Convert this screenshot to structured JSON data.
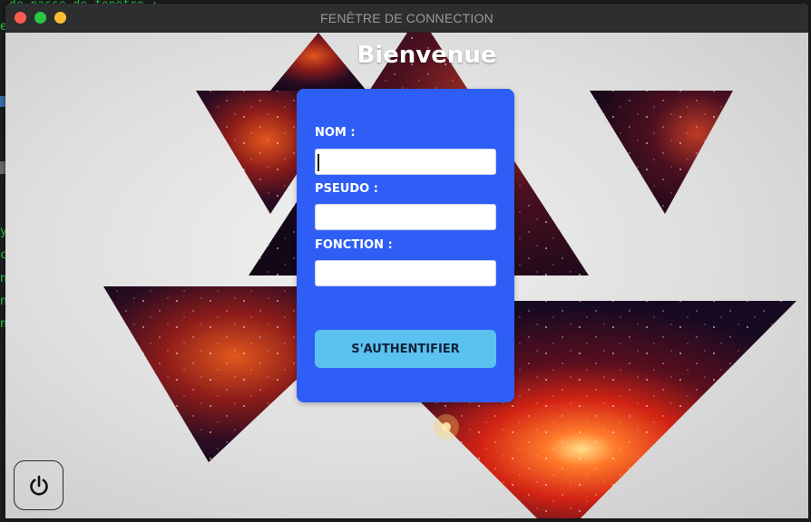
{
  "background_terminal": {
    "top_text": "de passe de fenêtre :",
    "fragments": [
      "es",
      "y",
      "c",
      "n",
      "n",
      "n"
    ]
  },
  "window": {
    "title": "FENÊTRE DE CONNECTION",
    "controls": [
      "close",
      "maximize",
      "minimize"
    ]
  },
  "header": {
    "welcome": "Bienvenue"
  },
  "form": {
    "nom_label": "NOM :",
    "nom_value": "",
    "pseudo_label": "PSEUDO :",
    "pseudo_value": "",
    "fonction_label": "FONCTION :",
    "fonction_value": "",
    "submit_label": "S'AUTHENTIFIER"
  },
  "power": {
    "icon": "power-icon"
  },
  "colors": {
    "panel": "#2f5ef6",
    "button": "#5bc1ee",
    "titlebar": "#2d2e30",
    "close": "#ff5b52",
    "maximize": "#2ac840",
    "minimize": "#fdbd30"
  }
}
